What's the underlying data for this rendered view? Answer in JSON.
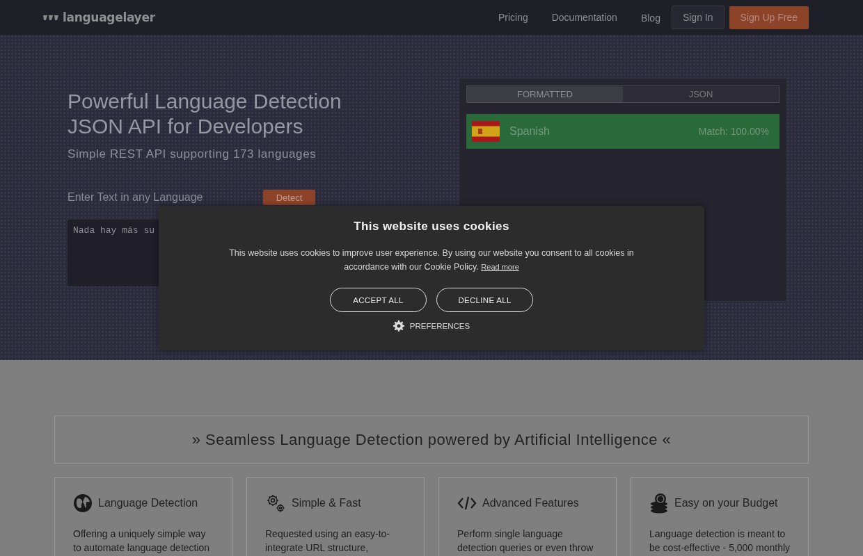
{
  "header": {
    "logo": "languagelayer",
    "nav": [
      {
        "label": "Pricing",
        "kind": "link"
      },
      {
        "label": "Documentation",
        "kind": "link"
      },
      {
        "label": "Blog",
        "kind": "link"
      },
      {
        "label": "Sign In",
        "kind": "outline"
      },
      {
        "label": "Sign Up Free",
        "kind": "primary"
      }
    ]
  },
  "hero": {
    "title_lines": [
      "Powerful Language Detection",
      "JSON API for Developers"
    ],
    "subtitle": "Simple REST API supporting 173 languages",
    "input_label": "Enter Text in any Language",
    "detect_button": "Detect",
    "input_value": "Nada hay más su"
  },
  "result": {
    "tabs": [
      {
        "label": "FORMATTED",
        "selected": true
      },
      {
        "label": "JSON",
        "selected": false
      }
    ],
    "language": "Spanish",
    "match": "Match: 100.00%"
  },
  "cookie_dialog": {
    "title": "This website uses cookies",
    "text": "This website uses cookies to improve user experience. By using our website you consent to all cookies in accordance with our Cookie Policy.",
    "link": "Read more",
    "buttons": [
      "ACCEPT ALL",
      "DECLINE ALL"
    ],
    "preferences": "PREFERENCES"
  },
  "banner": "» Seamless Language Detection powered by Artificial Intelligence «",
  "features": [
    {
      "kind": "globe",
      "title": "Language Detection",
      "lines": [
        "Offering a uniquely simple way",
        "to automate language detection"
      ]
    },
    {
      "kind": "gears",
      "title": "Simple & Fast",
      "lines": [
        "Requested using an easy-to-",
        "integrate URL structure,"
      ]
    },
    {
      "kind": "code",
      "title": "Advanced Features",
      "lines": [
        "Perform single language",
        "detection queries or even throw"
      ]
    },
    {
      "kind": "coins",
      "title": "Easy on your Budget",
      "lines": [
        "Language detection is meant to",
        "be cost-effective - 5,000 monthly"
      ]
    }
  ]
}
